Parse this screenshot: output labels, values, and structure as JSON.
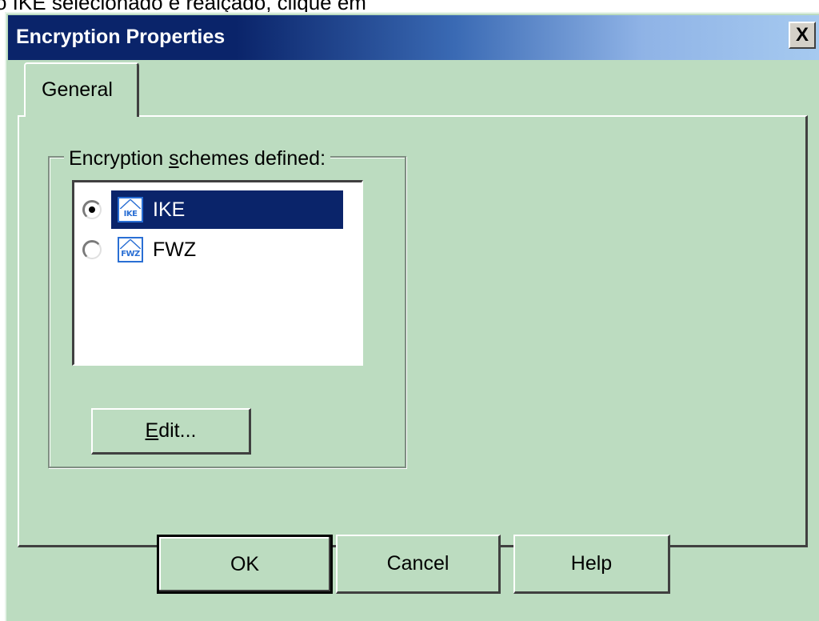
{
  "caption": {
    "text": "o IKE selecionado e realçado, clique em"
  },
  "dialog": {
    "title": "Encryption Properties",
    "close_glyph": "X",
    "colors": {
      "face": "#bcdcc0",
      "title_start": "#0a246a",
      "title_end": "#a6caf0",
      "selection": "#0a246a"
    }
  },
  "tabs": [
    {
      "label": "General",
      "selected": true
    }
  ],
  "group": {
    "label_before": "Encryption ",
    "label_underlined": "s",
    "label_after": "chemes defined:"
  },
  "schemes": [
    {
      "icon": "ike-scheme-icon",
      "icon_text": "IKE",
      "label": "IKE",
      "selected": true
    },
    {
      "icon": "fwz-scheme-icon",
      "icon_text": "FWZ",
      "label": "FWZ",
      "selected": false
    }
  ],
  "buttons": {
    "edit_underlined": "E",
    "edit_rest": "dit...",
    "ok": "OK",
    "cancel": "Cancel",
    "help": "Help"
  }
}
